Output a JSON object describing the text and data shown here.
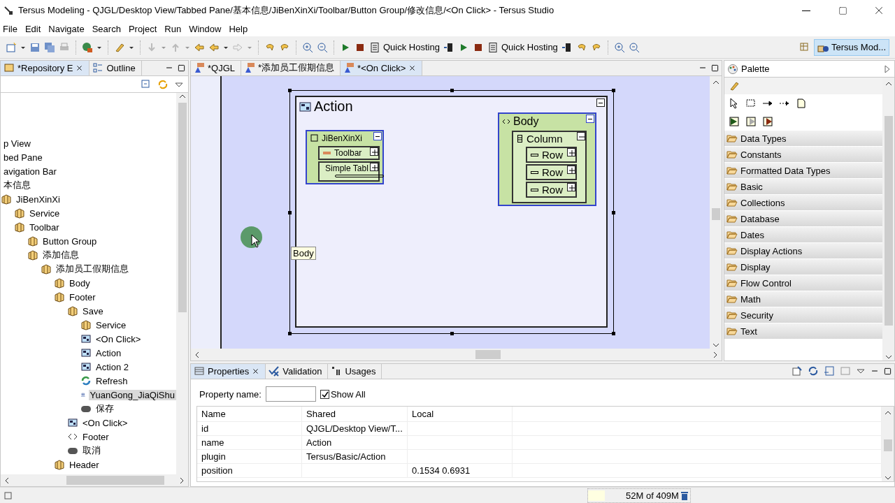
{
  "window": {
    "title": "Tersus Modeling - QJGL/Desktop View/Tabbed Pane/基本信息/JiBenXinXi/Toolbar/Button Group/修改信息/<On Click> - Tersus Studio"
  },
  "menu": [
    "File",
    "Edit",
    "Navigate",
    "Search",
    "Project",
    "Run",
    "Window",
    "Help"
  ],
  "toolbar": {
    "quick_hosting": [
      "Quick Hosting",
      "Quick Hosting"
    ],
    "perspective": "Tersus Mod..."
  },
  "left_panel": {
    "tabs": [
      {
        "label": "*Repository E",
        "selected": true
      },
      {
        "label": "Outline",
        "selected": false
      }
    ],
    "tree": [
      {
        "label": "p View",
        "children": [
          {
            "label": "bed Pane",
            "children": [
              {
                "label": "avigation Bar"
              },
              {
                "label": "本信息",
                "children": [
                  {
                    "label": "JiBenXinXi",
                    "kind": "component",
                    "children": [
                      {
                        "label": "Service",
                        "kind": "component"
                      },
                      {
                        "label": "Toolbar",
                        "kind": "component",
                        "children": [
                          {
                            "label": "Button Group",
                            "kind": "component"
                          },
                          {
                            "label": "添加信息",
                            "kind": "component",
                            "children": [
                              {
                                "label": "添加员工假期信息",
                                "kind": "component",
                                "children": [
                                  {
                                    "label": "Body",
                                    "kind": "component"
                                  },
                                  {
                                    "label": "Footer",
                                    "kind": "component",
                                    "children": [
                                      {
                                        "label": "Save",
                                        "kind": "component",
                                        "children": [
                                          {
                                            "label": "Service",
                                            "kind": "component"
                                          },
                                          {
                                            "label": "<On Click>",
                                            "kind": "action"
                                          },
                                          {
                                            "label": "Action",
                                            "kind": "action"
                                          },
                                          {
                                            "label": "Action 2",
                                            "kind": "action"
                                          },
                                          {
                                            "label": "Refresh",
                                            "kind": "refresh"
                                          },
                                          {
                                            "label": "YuanGong_JiaQiShu",
                                            "kind": "table",
                                            "selected": true
                                          },
                                          {
                                            "label": "保存",
                                            "kind": "button"
                                          }
                                        ]
                                      },
                                      {
                                        "label": "<On Click>",
                                        "kind": "action"
                                      },
                                      {
                                        "label": "Footer",
                                        "kind": "element"
                                      },
                                      {
                                        "label": "取消",
                                        "kind": "button"
                                      }
                                    ]
                                  },
                                  {
                                    "label": "Header",
                                    "kind": "component"
                                  }
                                ]
                              }
                            ]
                          }
                        ]
                      }
                    ]
                  }
                ]
              }
            ]
          }
        ]
      }
    ]
  },
  "editor": {
    "tabs": [
      {
        "label": "*QJGL",
        "selected": false
      },
      {
        "label": "*添加员工假期信息",
        "selected": false
      },
      {
        "label": "*<On Click>",
        "selected": true
      }
    ],
    "diagram": {
      "title": "Action",
      "tooltip": "Body",
      "nodes": [
        {
          "title": "JiBenXinXi",
          "kind": "panel",
          "children": [
            {
              "label": "Toolbar",
              "kind": "toolbar",
              "expanded": false
            },
            {
              "label": "Simple Tabl",
              "kind": "table",
              "expanded": false
            }
          ]
        },
        {
          "title": "Body",
          "kind": "element",
          "children": [
            {
              "label": "Column",
              "kind": "column",
              "expanded": true,
              "children": [
                {
                  "label": "Row",
                  "kind": "row",
                  "expanded": false
                },
                {
                  "label": "Row",
                  "kind": "row",
                  "expanded": false
                },
                {
                  "label": "Row",
                  "kind": "row",
                  "expanded": false
                }
              ]
            }
          ]
        }
      ]
    }
  },
  "palette": {
    "title": "Palette",
    "drawers": [
      "Data Types",
      "Constants",
      "Formatted Data Types",
      "Basic",
      "Collections",
      "Database",
      "Dates",
      "Display Actions",
      "Display",
      "Flow Control",
      "Math",
      "Security",
      "Text"
    ]
  },
  "properties": {
    "tabs": [
      {
        "label": "Properties",
        "selected": true
      },
      {
        "label": "Validation",
        "selected": false
      },
      {
        "label": "Usages",
        "selected": false
      }
    ],
    "filter_label": "Property name:",
    "show_all": {
      "label": "Show All",
      "checked": true
    },
    "columns": [
      "Name",
      "Shared",
      "Local"
    ],
    "rows": [
      [
        "id",
        "QJGL/Desktop View/T...",
        ""
      ],
      [
        "name",
        "Action",
        ""
      ],
      [
        "plugin",
        "Tersus/Basic/Action",
        ""
      ],
      [
        "position",
        "",
        "0.1534 0.6931"
      ]
    ]
  },
  "status_bar": {
    "memory": "52M of 409M"
  }
}
